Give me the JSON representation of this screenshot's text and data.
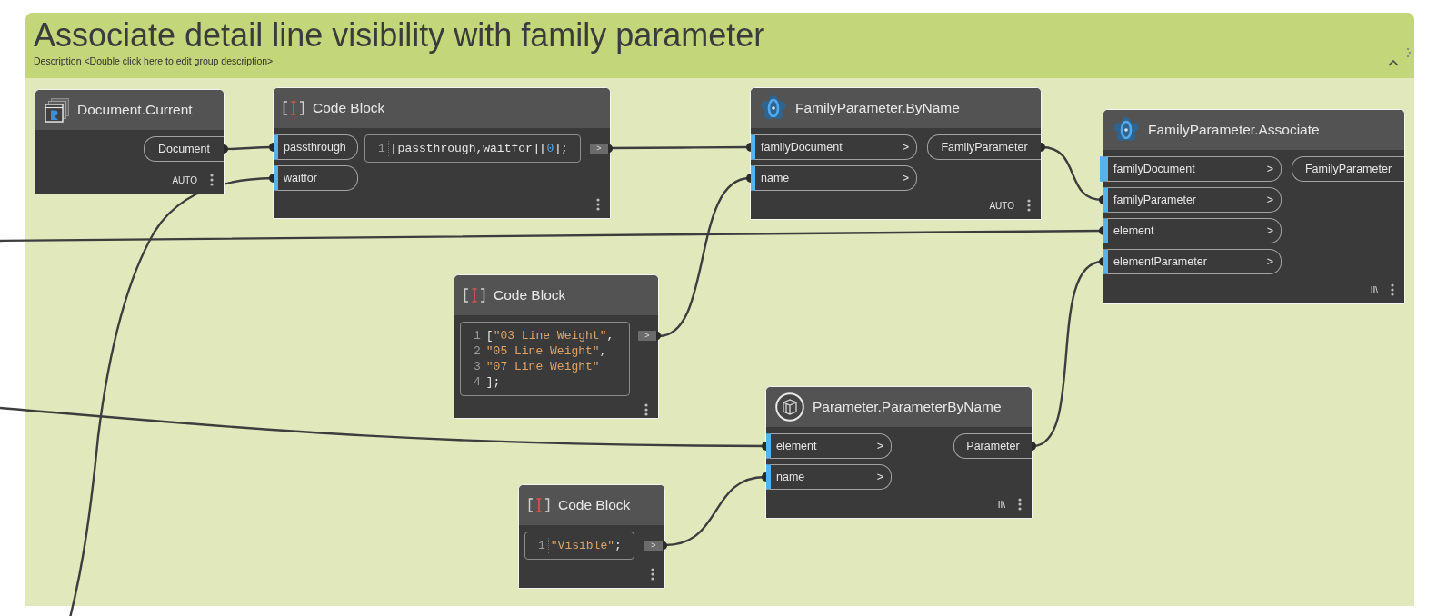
{
  "group": {
    "title": "Associate detail line visibility with family parameter",
    "description": "Description <Double click here to edit group description>"
  },
  "nodes": [
    {
      "kind": "function",
      "title": "Document.Current",
      "outputs": [
        {
          "name": "Document",
          "connected": true
        }
      ],
      "lacing": "AUTO"
    },
    {
      "kind": "code_block",
      "title": "Code Block",
      "inputs": [
        {
          "name": "passthrough",
          "connected": true
        },
        {
          "name": "waitfor",
          "connected": true
        }
      ],
      "code": [
        {
          "number": "1",
          "tokens": [
            {
              "kind": "plain",
              "text": "[passthrough,waitfor]["
            },
            {
              "kind": "number",
              "text": "0"
            },
            {
              "kind": "plain",
              "text": "];"
            }
          ]
        }
      ],
      "output": {
        "arrow": ">",
        "connected": true
      }
    },
    {
      "kind": "function",
      "title": "FamilyParameter.ByName",
      "inputs": [
        {
          "name": "familyDocument",
          "arrow": ">",
          "connected": true
        },
        {
          "name": "name",
          "arrow": ">",
          "connected": true
        }
      ],
      "outputs": [
        {
          "name": "FamilyParameter",
          "connected": true
        }
      ],
      "lacing": "AUTO"
    },
    {
      "kind": "function",
      "title": "FamilyParameter.Associate",
      "inputs": [
        {
          "name": "familyDocument",
          "arrow": ">",
          "connected": false
        },
        {
          "name": "familyParameter",
          "arrow": ">",
          "connected": true
        },
        {
          "name": "element",
          "arrow": ">",
          "connected": true
        },
        {
          "name": "elementParameter",
          "arrow": ">",
          "connected": true
        }
      ],
      "outputs": [
        {
          "name": "FamilyParameter",
          "connected": false
        }
      ],
      "lacing": "II\\"
    },
    {
      "kind": "code_block",
      "title": "Code Block",
      "code": [
        {
          "number": "1",
          "tokens": [
            {
              "kind": "plain",
              "text": "["
            },
            {
              "kind": "string",
              "text": "\"03 Line Weight\""
            },
            {
              "kind": "plain",
              "text": ","
            }
          ]
        },
        {
          "number": "2",
          "tokens": [
            {
              "kind": "string",
              "text": "\"05 Line Weight\""
            },
            {
              "kind": "plain",
              "text": ","
            }
          ]
        },
        {
          "number": "3",
          "tokens": [
            {
              "kind": "string",
              "text": "\"07 Line Weight\""
            }
          ]
        },
        {
          "number": "4",
          "tokens": [
            {
              "kind": "plain",
              "text": "];"
            }
          ]
        }
      ],
      "output": {
        "arrow": ">",
        "connected": true
      }
    },
    {
      "kind": "function",
      "title": "Parameter.ParameterByName",
      "inputs": [
        {
          "name": "element",
          "arrow": ">",
          "connected": true
        },
        {
          "name": "name",
          "arrow": ">",
          "connected": true
        }
      ],
      "outputs": [
        {
          "name": "Parameter",
          "connected": true
        }
      ],
      "lacing": "II\\"
    },
    {
      "kind": "code_block",
      "title": "Code Block",
      "code": [
        {
          "number": "1",
          "tokens": [
            {
              "kind": "string",
              "text": "\"Visible\""
            },
            {
              "kind": "plain",
              "text": ";"
            }
          ]
        }
      ],
      "output": {
        "arrow": ">",
        "connected": true
      }
    }
  ]
}
